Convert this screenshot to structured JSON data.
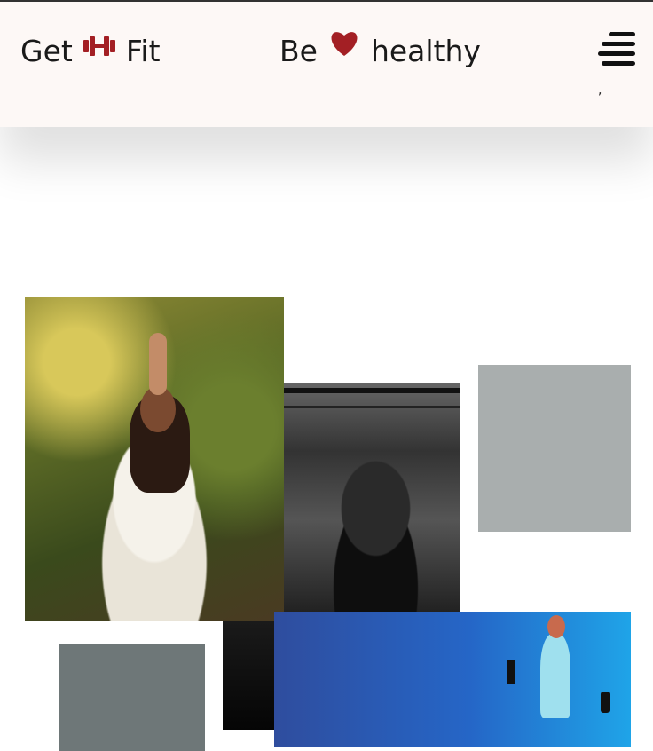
{
  "header": {
    "left_text_1": "Get",
    "left_icon": "dumbbell-icon",
    "left_text_2": "Fit",
    "mid_text_1": "Be",
    "mid_icon": "heart-icon",
    "mid_text_2": "healthy",
    "menu_icon": "hamburger-menu-icon",
    "stray_mark": ","
  },
  "colors": {
    "accent": "#a31f24",
    "header_bg": "#fdf8f6",
    "text": "#1a1a1a"
  },
  "gallery": {
    "tiles": [
      "yoga-photo",
      "pullup-photo",
      "gray-placeholder",
      "dark-photo-strip",
      "gray-placeholder",
      "dumbbell-workout-photo"
    ]
  }
}
